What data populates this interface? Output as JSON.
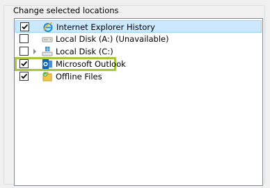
{
  "group": {
    "title": "Change selected locations"
  },
  "items": [
    {
      "label": "Internet Explorer History",
      "checked": true,
      "icon": "internet-explorer-icon"
    },
    {
      "label": "Local Disk (A:) (Unavailable)",
      "checked": false,
      "icon": "drive-icon"
    },
    {
      "label": "Local Disk (C:)",
      "checked": false,
      "icon": "windows-drive-icon"
    },
    {
      "label": "Microsoft Outlook",
      "checked": true,
      "icon": "outlook-icon"
    },
    {
      "label": "Offline Files",
      "checked": true,
      "icon": "offline-files-icon"
    }
  ]
}
